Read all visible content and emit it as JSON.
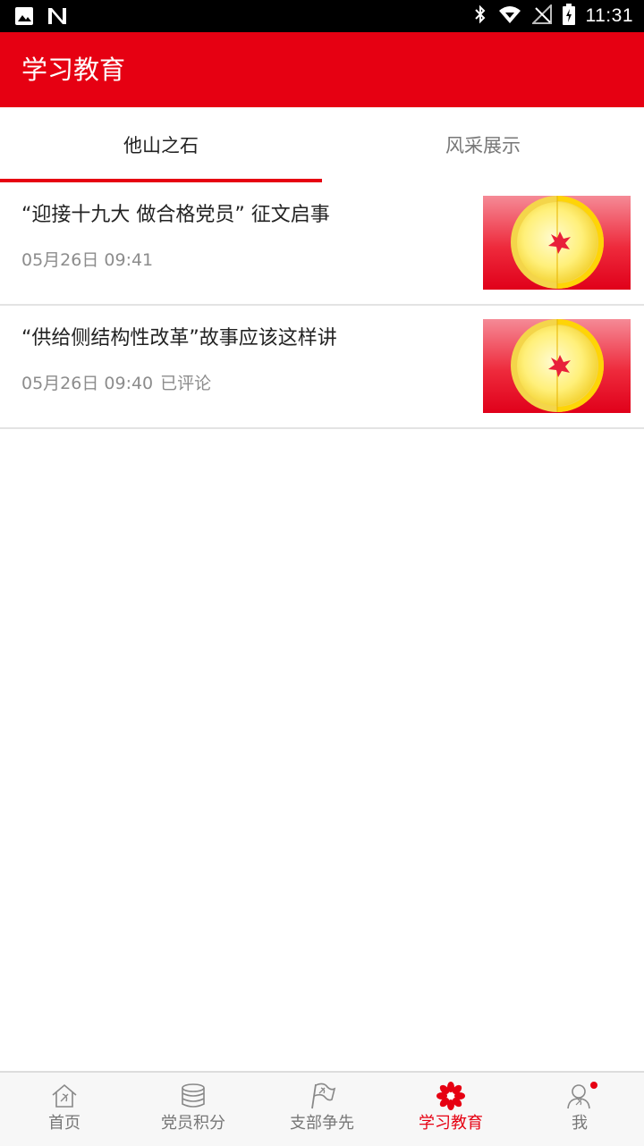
{
  "status_bar": {
    "time": "11:31",
    "left_icons": [
      "image-icon",
      "n-logo-icon"
    ],
    "right_icons": [
      "bluetooth-icon",
      "wifi-icon",
      "no-signal-icon",
      "battery-charging-icon"
    ]
  },
  "app_bar": {
    "title": "学习教育",
    "color": "#e60012"
  },
  "tabs": [
    {
      "label": "他山之石",
      "active": true
    },
    {
      "label": "风采展示",
      "active": false
    }
  ],
  "articles": [
    {
      "title": "“迎接十九大 做合格党员” 征文启事",
      "time": "05月26日 09:41",
      "comment": ""
    },
    {
      "title": "“供给侧结构性改革”故事应该这样讲",
      "time": "05月26日 09:40",
      "comment": "已评论"
    }
  ],
  "bottom_nav": [
    {
      "label": "首页",
      "icon": "home-icon"
    },
    {
      "label": "党员积分",
      "icon": "coins-stack-icon"
    },
    {
      "label": "支部争先",
      "icon": "party-flag-icon"
    },
    {
      "label": "学习教育",
      "icon": "flower-icon",
      "active": true
    },
    {
      "label": "我",
      "icon": "user-icon",
      "badge": true
    }
  ]
}
